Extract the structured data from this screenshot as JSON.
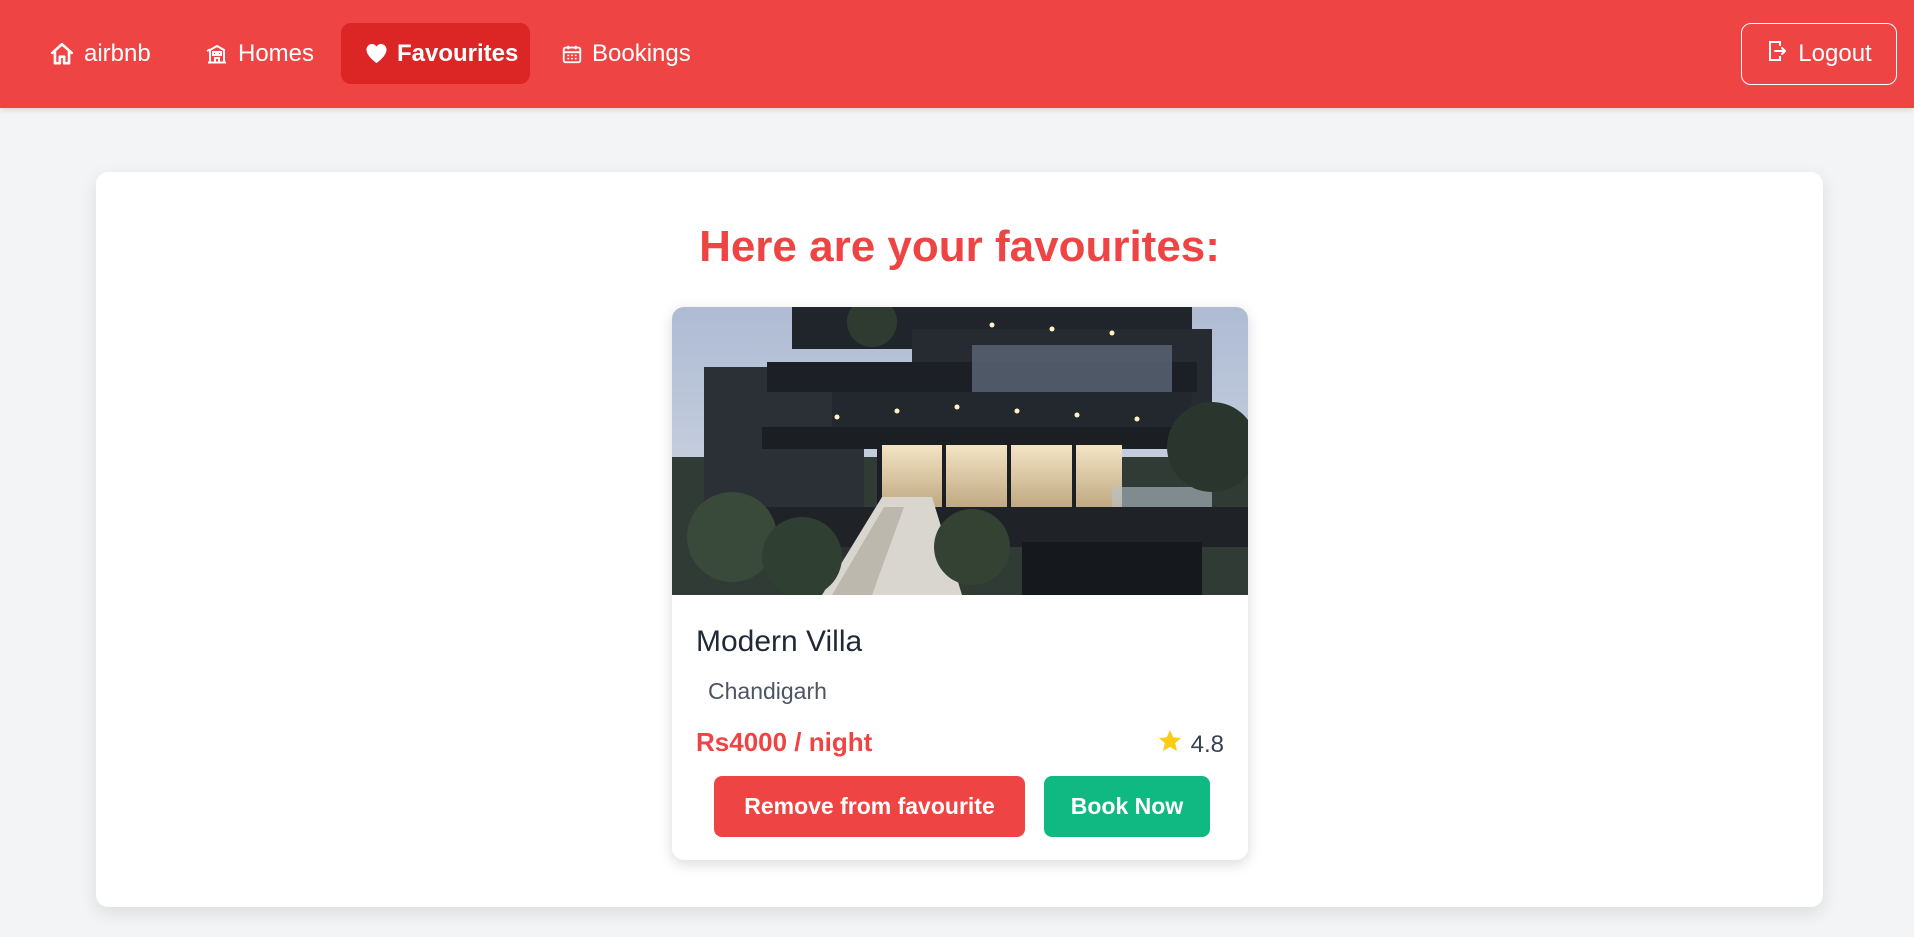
{
  "nav": {
    "brand": "airbnb",
    "homes": "Homes",
    "favourites": "Favourites",
    "bookings": "Bookings",
    "logout": "Logout",
    "active_item": "Favourites"
  },
  "page": {
    "title": "Here are your favourites:"
  },
  "favourites": [
    {
      "name": "Modern Villa",
      "location": "Chandigarh",
      "price": "Rs4000 / night",
      "rating": "4.8",
      "remove_label": "Remove from favourite",
      "book_label": "Book Now"
    }
  ],
  "colors": {
    "brand": "#ef4444",
    "active_nav": "#dc2626",
    "book_button": "#10b981",
    "star": "#facc15"
  },
  "icons": {
    "brand": "house-icon",
    "homes": "building-icon",
    "favourites": "heart-icon",
    "bookings": "calendar-icon",
    "logout": "logout-icon",
    "rating": "star-icon"
  }
}
